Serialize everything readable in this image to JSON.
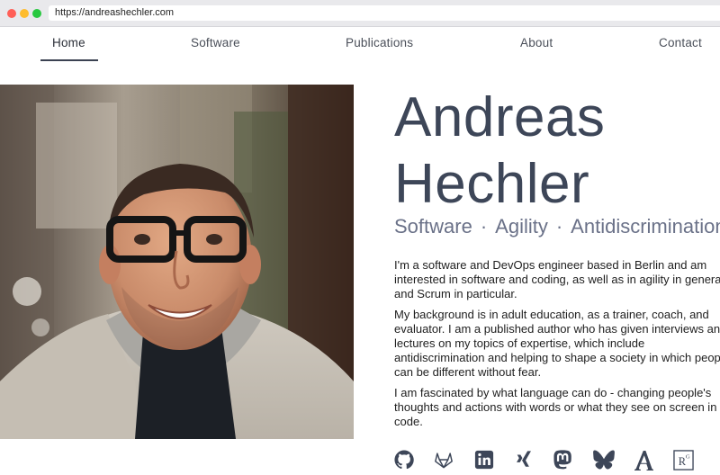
{
  "browser": {
    "url": "https://andreashechler.com"
  },
  "nav": {
    "items": [
      {
        "label": "Home"
      },
      {
        "label": "Software"
      },
      {
        "label": "Publications"
      },
      {
        "label": "About"
      },
      {
        "label": "Contact"
      }
    ],
    "active": "Home"
  },
  "hero": {
    "name_line1": "Andreas",
    "name_line2": "Hechler",
    "tagline": [
      "Software",
      "Agility",
      "Antidiscrimination"
    ],
    "tagline_separator": "·",
    "bio": [
      "I'm a software and DevOps engineer based in Berlin and am interested in software and coding, as well as in agility in general and Scrum in particular.",
      "My background is in adult education, as a trainer, coach, and evaluator. I am a published author who has given interviews and lectures on my topics of expertise, which include antidiscrimination and helping to shape a society in which people can be different without fear.",
      "I am fascinated by what language can do - changing people's thoughts and actions with words or what they see on screen in code."
    ]
  },
  "socials": [
    {
      "icon": "github-icon"
    },
    {
      "icon": "gitlab-icon"
    },
    {
      "icon": "linkedin-icon"
    },
    {
      "icon": "xing-icon"
    },
    {
      "icon": "mastodon-icon"
    },
    {
      "icon": "bluesky-icon"
    },
    {
      "icon": "academia-icon"
    },
    {
      "icon": "researchgate-icon"
    }
  ],
  "colors": {
    "heading": "#3d4658",
    "tagline": "#6a7188",
    "nav_underline": "#3b4252"
  }
}
